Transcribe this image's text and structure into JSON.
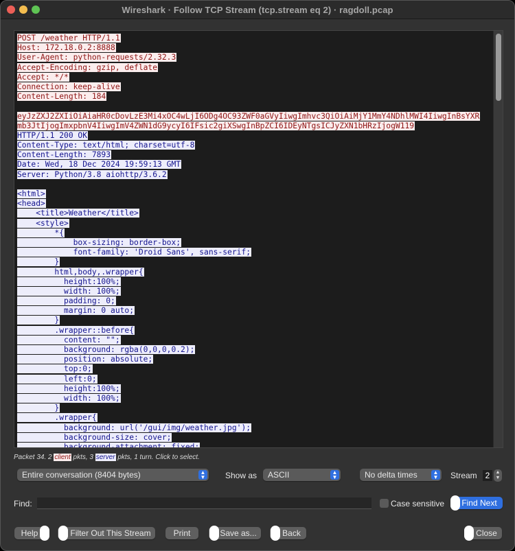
{
  "window": {
    "title": "Wireshark · Follow TCP Stream (tcp.stream eq 2) · ragdoll.pcap"
  },
  "stream": {
    "lines": [
      {
        "dir": "client",
        "text": "POST /weather HTTP/1.1"
      },
      {
        "dir": "client",
        "text": "Host: 172.18.0.2:8888"
      },
      {
        "dir": "client",
        "text": "User-Agent: python-requests/2.32.3"
      },
      {
        "dir": "client",
        "text": "Accept-Encoding: gzip, deflate"
      },
      {
        "dir": "client",
        "text": "Accept: */*"
      },
      {
        "dir": "client",
        "text": "Connection: keep-alive"
      },
      {
        "dir": "client",
        "text": "Content-Length: 184"
      },
      {
        "dir": "blank",
        "text": ""
      },
      {
        "dir": "client",
        "text": "eyJzZXJ2ZXIiOiAiaHR0cDovLzE3Mi4xOC4wLjI6ODg4OC93ZWF0aGVyIiwgImhvc3QiOiAiMjY1MmY4NDhlMWI4IiwgInBsYXR"
      },
      {
        "dir": "client",
        "text": "mb3JtIjogImxpbnV4IiwgImV4ZWN1dG9ycyI6IFsic2giXSwgInBpZCI6IDEyNTgsICJyZXN1bHRzIjogW119"
      },
      {
        "dir": "server",
        "text": "HTTP/1.1 200 OK"
      },
      {
        "dir": "server",
        "text": "Content-Type: text/html; charset=utf-8"
      },
      {
        "dir": "server",
        "text": "Content-Length: 7893"
      },
      {
        "dir": "server",
        "text": "Date: Wed, 18 Dec 2024 19:59:13 GMT"
      },
      {
        "dir": "server",
        "text": "Server: Python/3.8 aiohttp/3.6.2"
      },
      {
        "dir": "blank",
        "text": ""
      },
      {
        "dir": "server",
        "text": "<html>"
      },
      {
        "dir": "server",
        "text": "<head>"
      },
      {
        "dir": "server",
        "text": "    <title>Weather</title>"
      },
      {
        "dir": "server",
        "text": "    <style>"
      },
      {
        "dir": "server",
        "text": "        *{"
      },
      {
        "dir": "server",
        "text": "            box-sizing: border-box;"
      },
      {
        "dir": "server",
        "text": "            font-family: 'Droid Sans', sans-serif;"
      },
      {
        "dir": "server",
        "text": "        }"
      },
      {
        "dir": "server",
        "text": "        html,body,.wrapper{"
      },
      {
        "dir": "server",
        "text": "          height:100%;"
      },
      {
        "dir": "server",
        "text": "          width: 100%;"
      },
      {
        "dir": "server",
        "text": "          padding: 0;"
      },
      {
        "dir": "server",
        "text": "          margin: 0 auto;"
      },
      {
        "dir": "server",
        "text": "        }"
      },
      {
        "dir": "server",
        "text": "        .wrapper::before{"
      },
      {
        "dir": "server",
        "text": "          content: \"\";"
      },
      {
        "dir": "server",
        "text": "          background: rgba(0,0,0,0.2);"
      },
      {
        "dir": "server",
        "text": "          position: absolute;"
      },
      {
        "dir": "server",
        "text": "          top:0;"
      },
      {
        "dir": "server",
        "text": "          left:0;"
      },
      {
        "dir": "server",
        "text": "          height:100%;"
      },
      {
        "dir": "server",
        "text": "          width: 100%;"
      },
      {
        "dir": "server",
        "text": "        }"
      },
      {
        "dir": "server",
        "text": "        .wrapper{"
      },
      {
        "dir": "server",
        "text": "          background: url('/gui/img/weather.jpg');"
      },
      {
        "dir": "server",
        "text": "          background-size: cover;"
      },
      {
        "dir": "server",
        "text": "          background-attachment: fixed;"
      }
    ]
  },
  "info": {
    "prefix": "Packet 34. 2 ",
    "client_tag": "client",
    "middle": " pkts, 3 ",
    "server_tag": "server",
    "suffix": " pkts, 1 turn. Click to select."
  },
  "controls": {
    "conversation_select": "Entire conversation (8404 bytes)",
    "show_as_label": "Show as",
    "show_as_value": "ASCII",
    "delta_select": "No delta times",
    "stream_label": "Stream",
    "stream_value": "2",
    "find_label": "Find:",
    "find_value": "",
    "case_sensitive_label": "Case sensitive",
    "case_sensitive_checked": false,
    "find_next_label": "Find Next"
  },
  "buttons": {
    "help": "Help",
    "filter_out": "Filter Out This Stream",
    "print": "Print",
    "save_as": "Save as...",
    "back": "Back",
    "close": "Close"
  },
  "colors": {
    "client_bg": "#fbeded",
    "client_fg": "#8e1414",
    "server_bg": "#ededfb",
    "server_fg": "#14148e",
    "accent": "#2f6fe0"
  }
}
